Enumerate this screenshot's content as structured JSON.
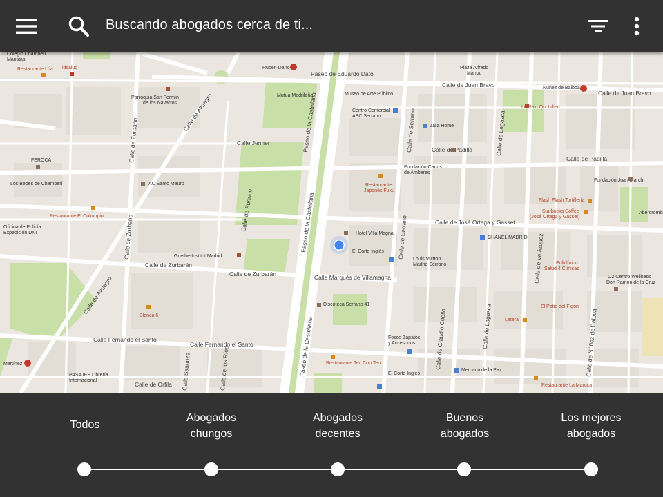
{
  "appbar": {
    "title": "Buscando abogados cerca de ti...",
    "menu_icon": "hamburger-menu-icon",
    "search_icon": "search-icon",
    "filter_icon": "filter-icon",
    "more_icon": "more-vert-icon"
  },
  "map": {
    "streets": [
      "Paseo de Eduardo Dato",
      "Calle de Juan Bravo",
      "Calle Jenner",
      "Calle de Padilla",
      "Calle de José Ortega y Gasset",
      "Calle de Zurbarán",
      "Calle Marqués de Villamagna",
      "Calle Fernando el Santo",
      "Calle de Orfila",
      "Paseo de la Castellana",
      "Calle de Serrano",
      "Calle de Lagasca",
      "Calle de Velázquez",
      "Calle de Núñez de Balboa",
      "Calle de Almagro",
      "Calle de Zurbano",
      "Calle de Fortuny",
      "Calle de Claudio Coello",
      "Calle de los Ríos",
      "Calle Saaunza"
    ],
    "places": [
      "Rubén Darío",
      "Plaza Alfredo Mahou",
      "Núñez de Balboa",
      "Museo de Arte Público",
      "Mutua Madrileña",
      "Centro Comercial ABC Serrano",
      "Zara Home",
      "Le Pain Quotidien",
      "Parroquia San Fermín de los Navarros",
      "Fundación Carlos de Amberes",
      "Restaurante Japonés Fuku",
      "FEROCA",
      "AC Santo Mauro",
      "Los Bebes de Chamberí",
      "Fundación Juan March",
      "Flash Flash Tortillería",
      "Starbucks Coffee (José Ortega y Gasset)",
      "Restaurante El Columpio",
      "Oficina de Policía: Expedición DNI",
      "Hotel Villa Magna",
      "El Corte Inglés",
      "Louis Vuitton Madrid Serrano",
      "CHANEL MADRID",
      "Goethe-Institut Madrid",
      "Policlínico Salud 4 Clínicas",
      "O2 Centro Wellness Don Ramón de la Cruz",
      "Discoteca Serrano 41",
      "El Patio del Figón",
      "Blanca 6",
      "Lateral",
      "Fosco Zapatos y Accesorios",
      "Restaurante Ten Con Ten",
      "Mercado de la Paz",
      "PASAJES Librería Internacional",
      "El Corte Inglés",
      "Restaurante La Maruca",
      "Restaurante Lúa",
      "idsalud",
      "Abercrombie",
      "Colegio Chamberí Maristas"
    ]
  },
  "filters": {
    "steps": [
      {
        "label": "Todos"
      },
      {
        "label": "Abogados\nchungos"
      },
      {
        "label": "Abogados\ndecentes"
      },
      {
        "label": "Buenos\nabogados"
      },
      {
        "label": "Los mejores\nabogados"
      }
    ]
  }
}
